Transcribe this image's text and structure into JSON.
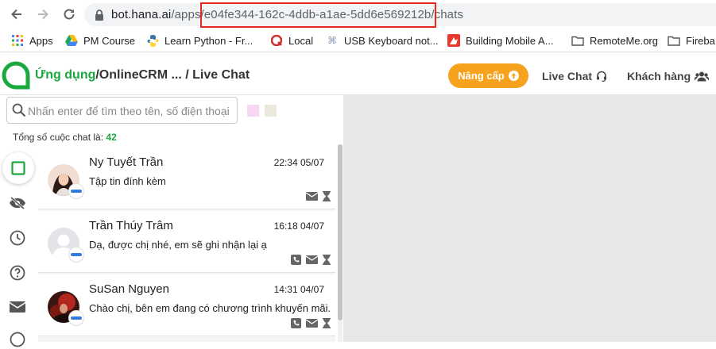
{
  "browser": {
    "url_host": "bot.hana.ai",
    "url_prefix": "/apps/",
    "url_id": "e04fe344-162c-4ddb-a1ae-5dd6e569212b",
    "url_suffix": "/chats",
    "highlight_color": "#e8271f"
  },
  "bookmarks": [
    {
      "label": "Apps",
      "icon": "apps-grid-icon"
    },
    {
      "label": "PM Course",
      "icon": "google-drive-icon"
    },
    {
      "label": "Learn Python - Fr...",
      "icon": "python-icon"
    },
    {
      "label": "Local",
      "icon": "local-icon"
    },
    {
      "label": "USB Keyboard not...",
      "icon": "command-key-icon"
    },
    {
      "label": "Building Mobile A...",
      "icon": "bookmark-site-icon"
    },
    {
      "label": "RemoteMe.org",
      "icon": "folder-icon"
    },
    {
      "label": "Fireba",
      "icon": "folder-icon"
    }
  ],
  "app": {
    "brand_apps": "Ứng dụng",
    "brand_path": "/OnlineCRM ... / Live Chat",
    "upgrade_label": "Nâng cấp",
    "live_chat_label": "Live Chat",
    "customers_label": "Khách hàng",
    "accent": "#1aa83f",
    "upgrade_color": "#f6a21c"
  },
  "search": {
    "placeholder": "Nhấn enter để tìm theo tên, số điện thoại"
  },
  "summary": {
    "label": "Tổng số cuộc chat là: ",
    "count": "42"
  },
  "chats": [
    {
      "name": "Ny Tuyết Trần",
      "time": "22:34 05/07",
      "message": "Tập tin đính kèm",
      "actions": [
        "mail-icon",
        "hourglass-icon"
      ]
    },
    {
      "name": "Trần Thúy Trâm",
      "time": "16:18 04/07",
      "message": "Dạ, được chị nhé, em sẽ ghi nhận lại ạ",
      "actions": [
        "phone-icon",
        "mail-icon",
        "hourglass-icon"
      ]
    },
    {
      "name": "SuSan Nguyen",
      "time": "14:31 04/07",
      "message": "Chào chị, bên em đang có chương trình khuyến mãi...",
      "actions": [
        "phone-icon",
        "mail-icon",
        "hourglass-icon"
      ]
    }
  ]
}
